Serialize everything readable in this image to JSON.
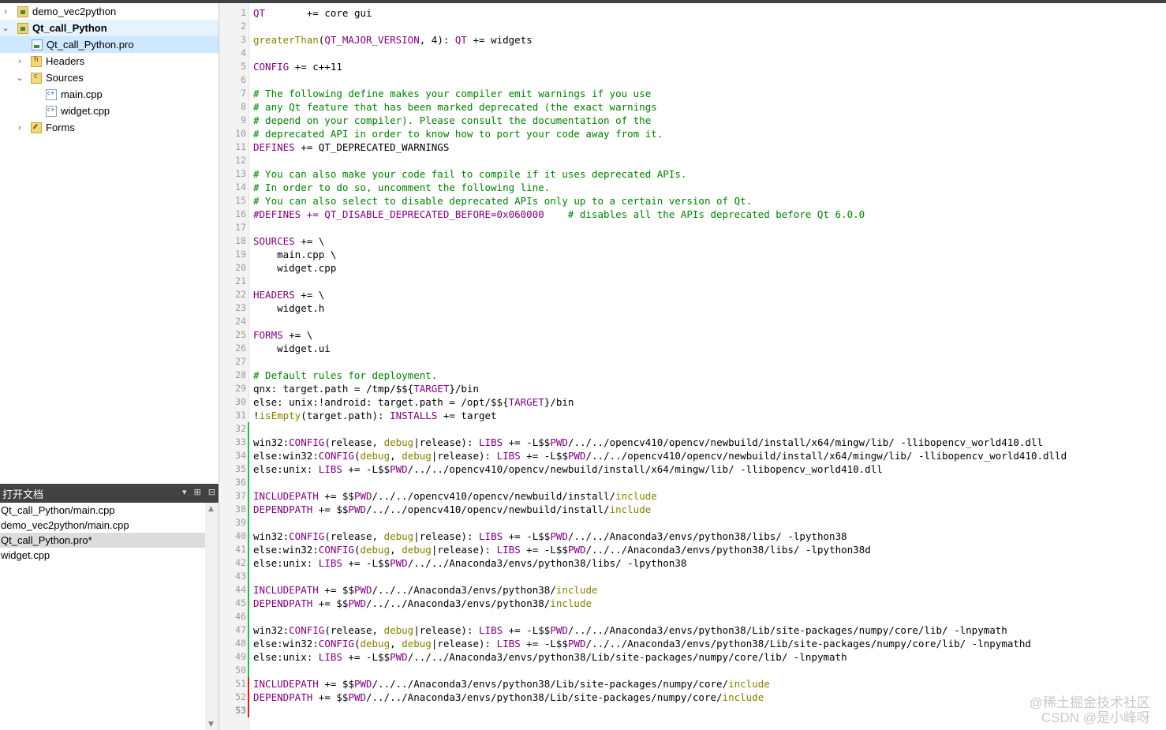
{
  "tree": {
    "items": [
      {
        "label": "demo_vec2python",
        "icon": "project-icon",
        "expanded": false
      },
      {
        "label": "Qt_call_Python",
        "icon": "project-icon",
        "expanded": true
      },
      {
        "label": "Qt_call_Python.pro",
        "icon": "pro-file-icon"
      },
      {
        "label": "Headers",
        "icon": "headers-folder-icon",
        "expanded": false
      },
      {
        "label": "Sources",
        "icon": "sources-folder-icon",
        "expanded": true
      },
      {
        "label": "main.cpp",
        "icon": "cpp-file-icon"
      },
      {
        "label": "widget.cpp",
        "icon": "cpp-file-icon"
      },
      {
        "label": "Forms",
        "icon": "forms-folder-icon",
        "expanded": false
      }
    ]
  },
  "open_documents": {
    "title": "打开文档",
    "items": [
      {
        "label": "Qt_call_Python/main.cpp"
      },
      {
        "label": "demo_vec2python/main.cpp"
      },
      {
        "label": "Qt_call_Python.pro*",
        "selected": true
      },
      {
        "label": "widget.cpp"
      }
    ]
  },
  "editor": {
    "file": "Qt_call_Python.pro",
    "lines": [
      "QT       += core gui",
      "",
      "greaterThan(QT_MAJOR_VERSION, 4): QT += widgets",
      "",
      "CONFIG += c++11",
      "",
      "# The following define makes your compiler emit warnings if you use",
      "# any Qt feature that has been marked deprecated (the exact warnings",
      "# depend on your compiler). Please consult the documentation of the",
      "# deprecated API in order to know how to port your code away from it.",
      "DEFINES += QT_DEPRECATED_WARNINGS",
      "",
      "# You can also make your code fail to compile if it uses deprecated APIs.",
      "# In order to do so, uncomment the following line.",
      "# You can also select to disable deprecated APIs only up to a certain version of Qt.",
      "#DEFINES += QT_DISABLE_DEPRECATED_BEFORE=0x060000    # disables all the APIs deprecated before Qt 6.0.0",
      "",
      "SOURCES += \\",
      "    main.cpp \\",
      "    widget.cpp",
      "",
      "HEADERS += \\",
      "    widget.h",
      "",
      "FORMS += \\",
      "    widget.ui",
      "",
      "# Default rules for deployment.",
      "qnx: target.path = /tmp/$${TARGET}/bin",
      "else: unix:!android: target.path = /opt/$${TARGET}/bin",
      "!isEmpty(target.path): INSTALLS += target",
      "",
      "win32:CONFIG(release, debug|release): LIBS += -L$$PWD/../../opencv410/opencv/newbuild/install/x64/mingw/lib/ -llibopencv_world410.dll",
      "else:win32:CONFIG(debug, debug|release): LIBS += -L$$PWD/../../opencv410/opencv/newbuild/install/x64/mingw/lib/ -llibopencv_world410.dlld",
      "else:unix: LIBS += -L$$PWD/../../opencv410/opencv/newbuild/install/x64/mingw/lib/ -llibopencv_world410.dll",
      "",
      "INCLUDEPATH += $$PWD/../../opencv410/opencv/newbuild/install/include",
      "DEPENDPATH += $$PWD/../../opencv410/opencv/newbuild/install/include",
      "",
      "win32:CONFIG(release, debug|release): LIBS += -L$$PWD/../../Anaconda3/envs/python38/libs/ -lpython38",
      "else:win32:CONFIG(debug, debug|release): LIBS += -L$$PWD/../../Anaconda3/envs/python38/libs/ -lpython38d",
      "else:unix: LIBS += -L$$PWD/../../Anaconda3/envs/python38/libs/ -lpython38",
      "",
      "INCLUDEPATH += $$PWD/../../Anaconda3/envs/python38/include",
      "DEPENDPATH += $$PWD/../../Anaconda3/envs/python38/include",
      "",
      "win32:CONFIG(release, debug|release): LIBS += -L$$PWD/../../Anaconda3/envs/python38/Lib/site-packages/numpy/core/lib/ -lnpymath",
      "else:win32:CONFIG(debug, debug|release): LIBS += -L$$PWD/../../Anaconda3/envs/python38/Lib/site-packages/numpy/core/lib/ -lnpymathd",
      "else:unix: LIBS += -L$$PWD/../../Anaconda3/envs/python38/Lib/site-packages/numpy/core/lib/ -lnpymath",
      "",
      "INCLUDEPATH += $$PWD/../../Anaconda3/envs/python38/Lib/site-packages/numpy/core/include",
      "DEPENDPATH += $$PWD/../../Anaconda3/envs/python38/Lib/site-packages/numpy/core/include",
      ""
    ],
    "current_line": 53,
    "change_marks": {
      "green": [
        32,
        50
      ],
      "red": [
        51,
        53
      ]
    }
  },
  "watermark": {
    "line1": "@稀土掘金技术社区",
    "line2": "CSDN @是小峰呀"
  },
  "colors": {
    "keyword": "#800080",
    "comment": "#008000",
    "function": "#808000",
    "change_green": "#2db34a",
    "change_red": "#d02020"
  }
}
